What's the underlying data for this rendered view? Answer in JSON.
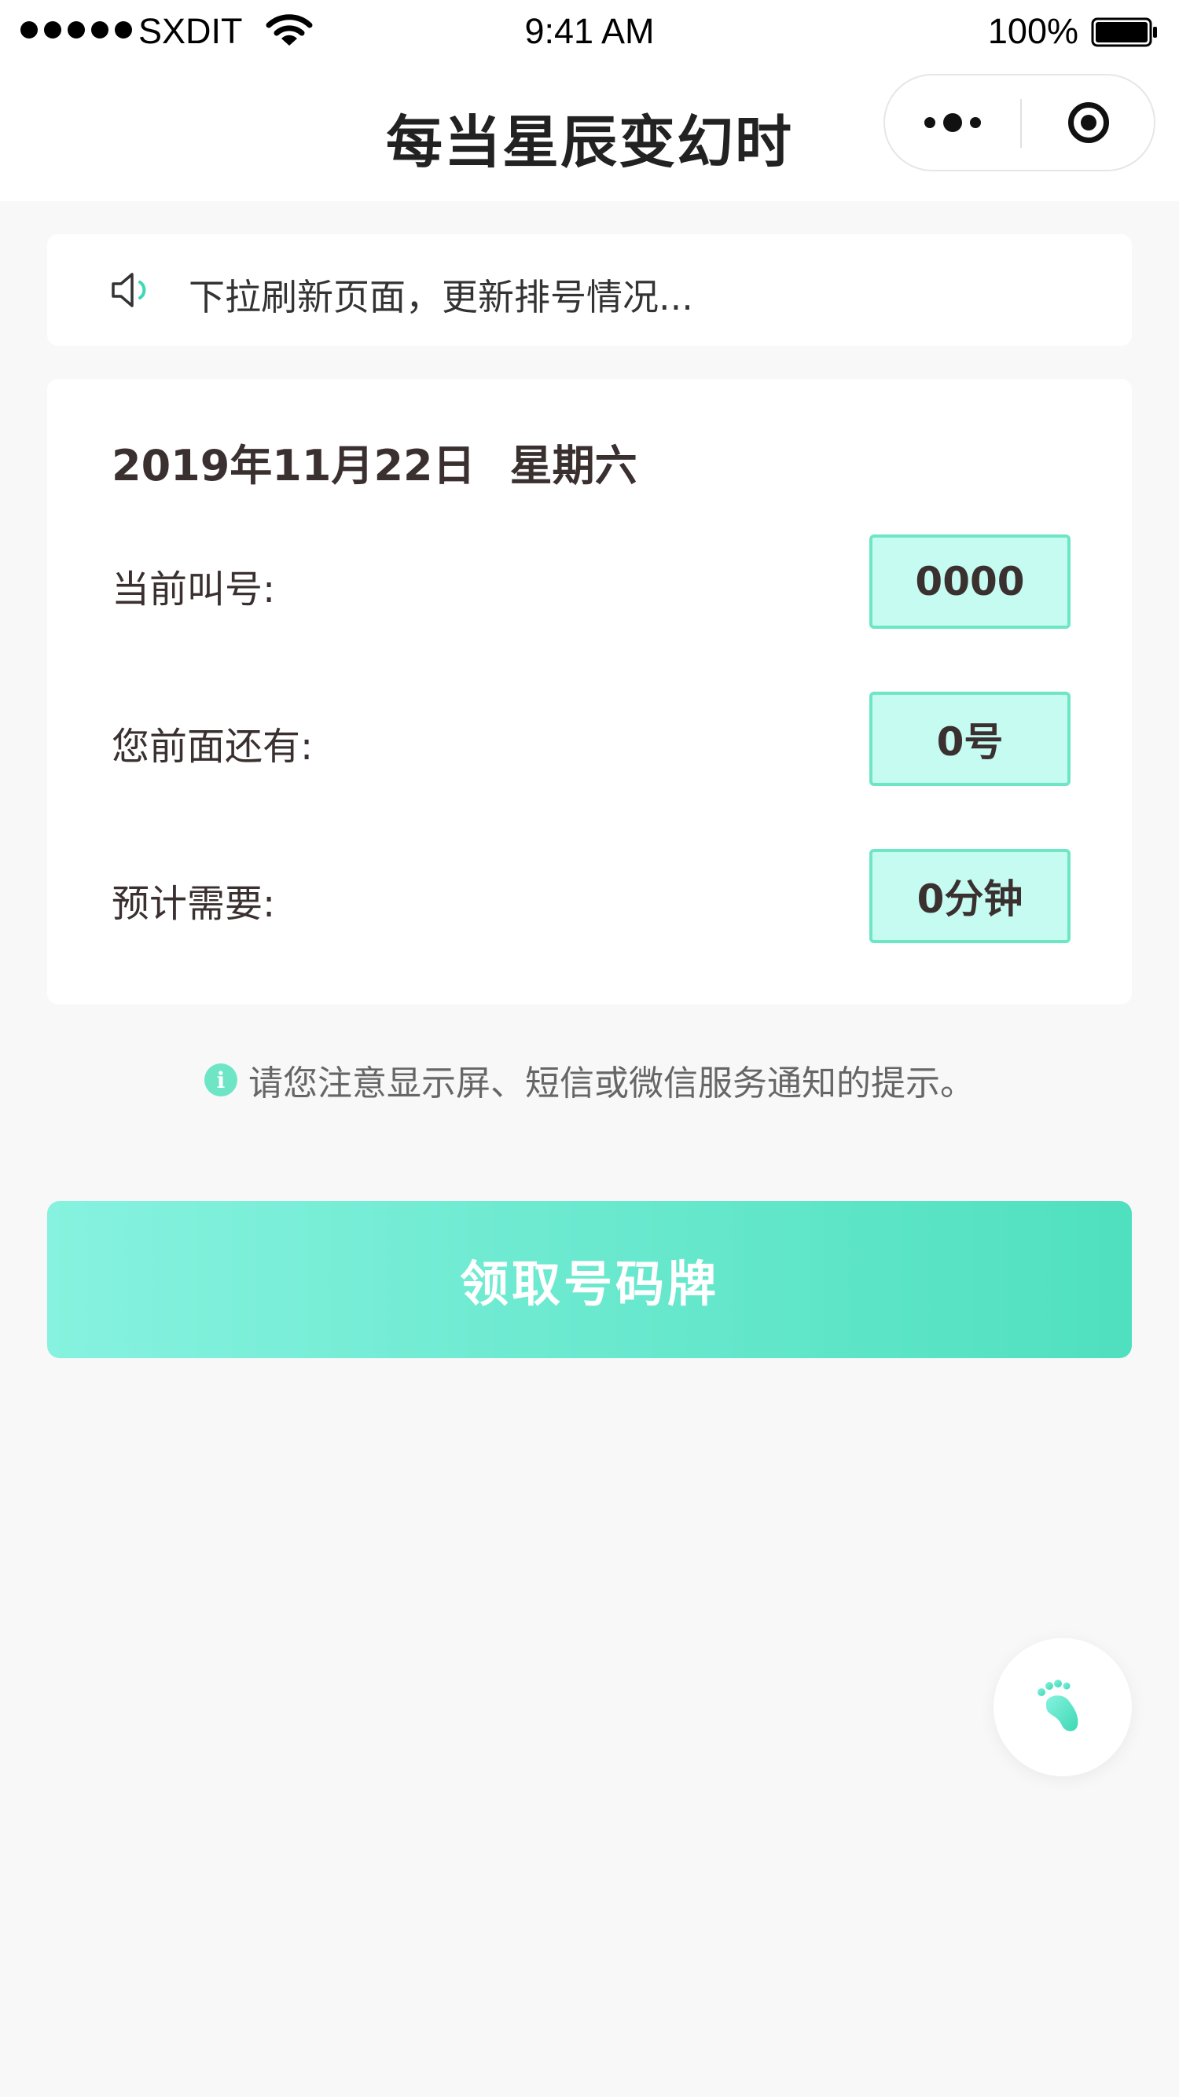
{
  "status_bar": {
    "carrier": "SXDIT",
    "time": "9:41 AM",
    "battery": "100%"
  },
  "nav": {
    "title": "每当星辰变幻时"
  },
  "notice": {
    "text": "下拉刷新页面，更新排号情况..."
  },
  "card": {
    "date": "2019年11月22日",
    "weekday": "星期六",
    "rows": [
      {
        "label": "当前叫号:",
        "value": "0000"
      },
      {
        "label": "您前面还有:",
        "value": "0号"
      },
      {
        "label": "预计需要:",
        "value": "0分钟"
      }
    ]
  },
  "tip": {
    "text": "请您注意显示屏、短信或微信服务通知的提示。"
  },
  "action": {
    "label": "领取号码牌"
  },
  "icons": {
    "notice": "speaker-icon",
    "tip": "info-icon",
    "fab": "footprint-icon",
    "more": "more-icon",
    "close": "close-target-icon"
  },
  "colors": {
    "accent": "#6ee6c6",
    "value_bg": "#c6fbf1",
    "button_start": "#86f2df",
    "button_end": "#4fe0bf"
  }
}
